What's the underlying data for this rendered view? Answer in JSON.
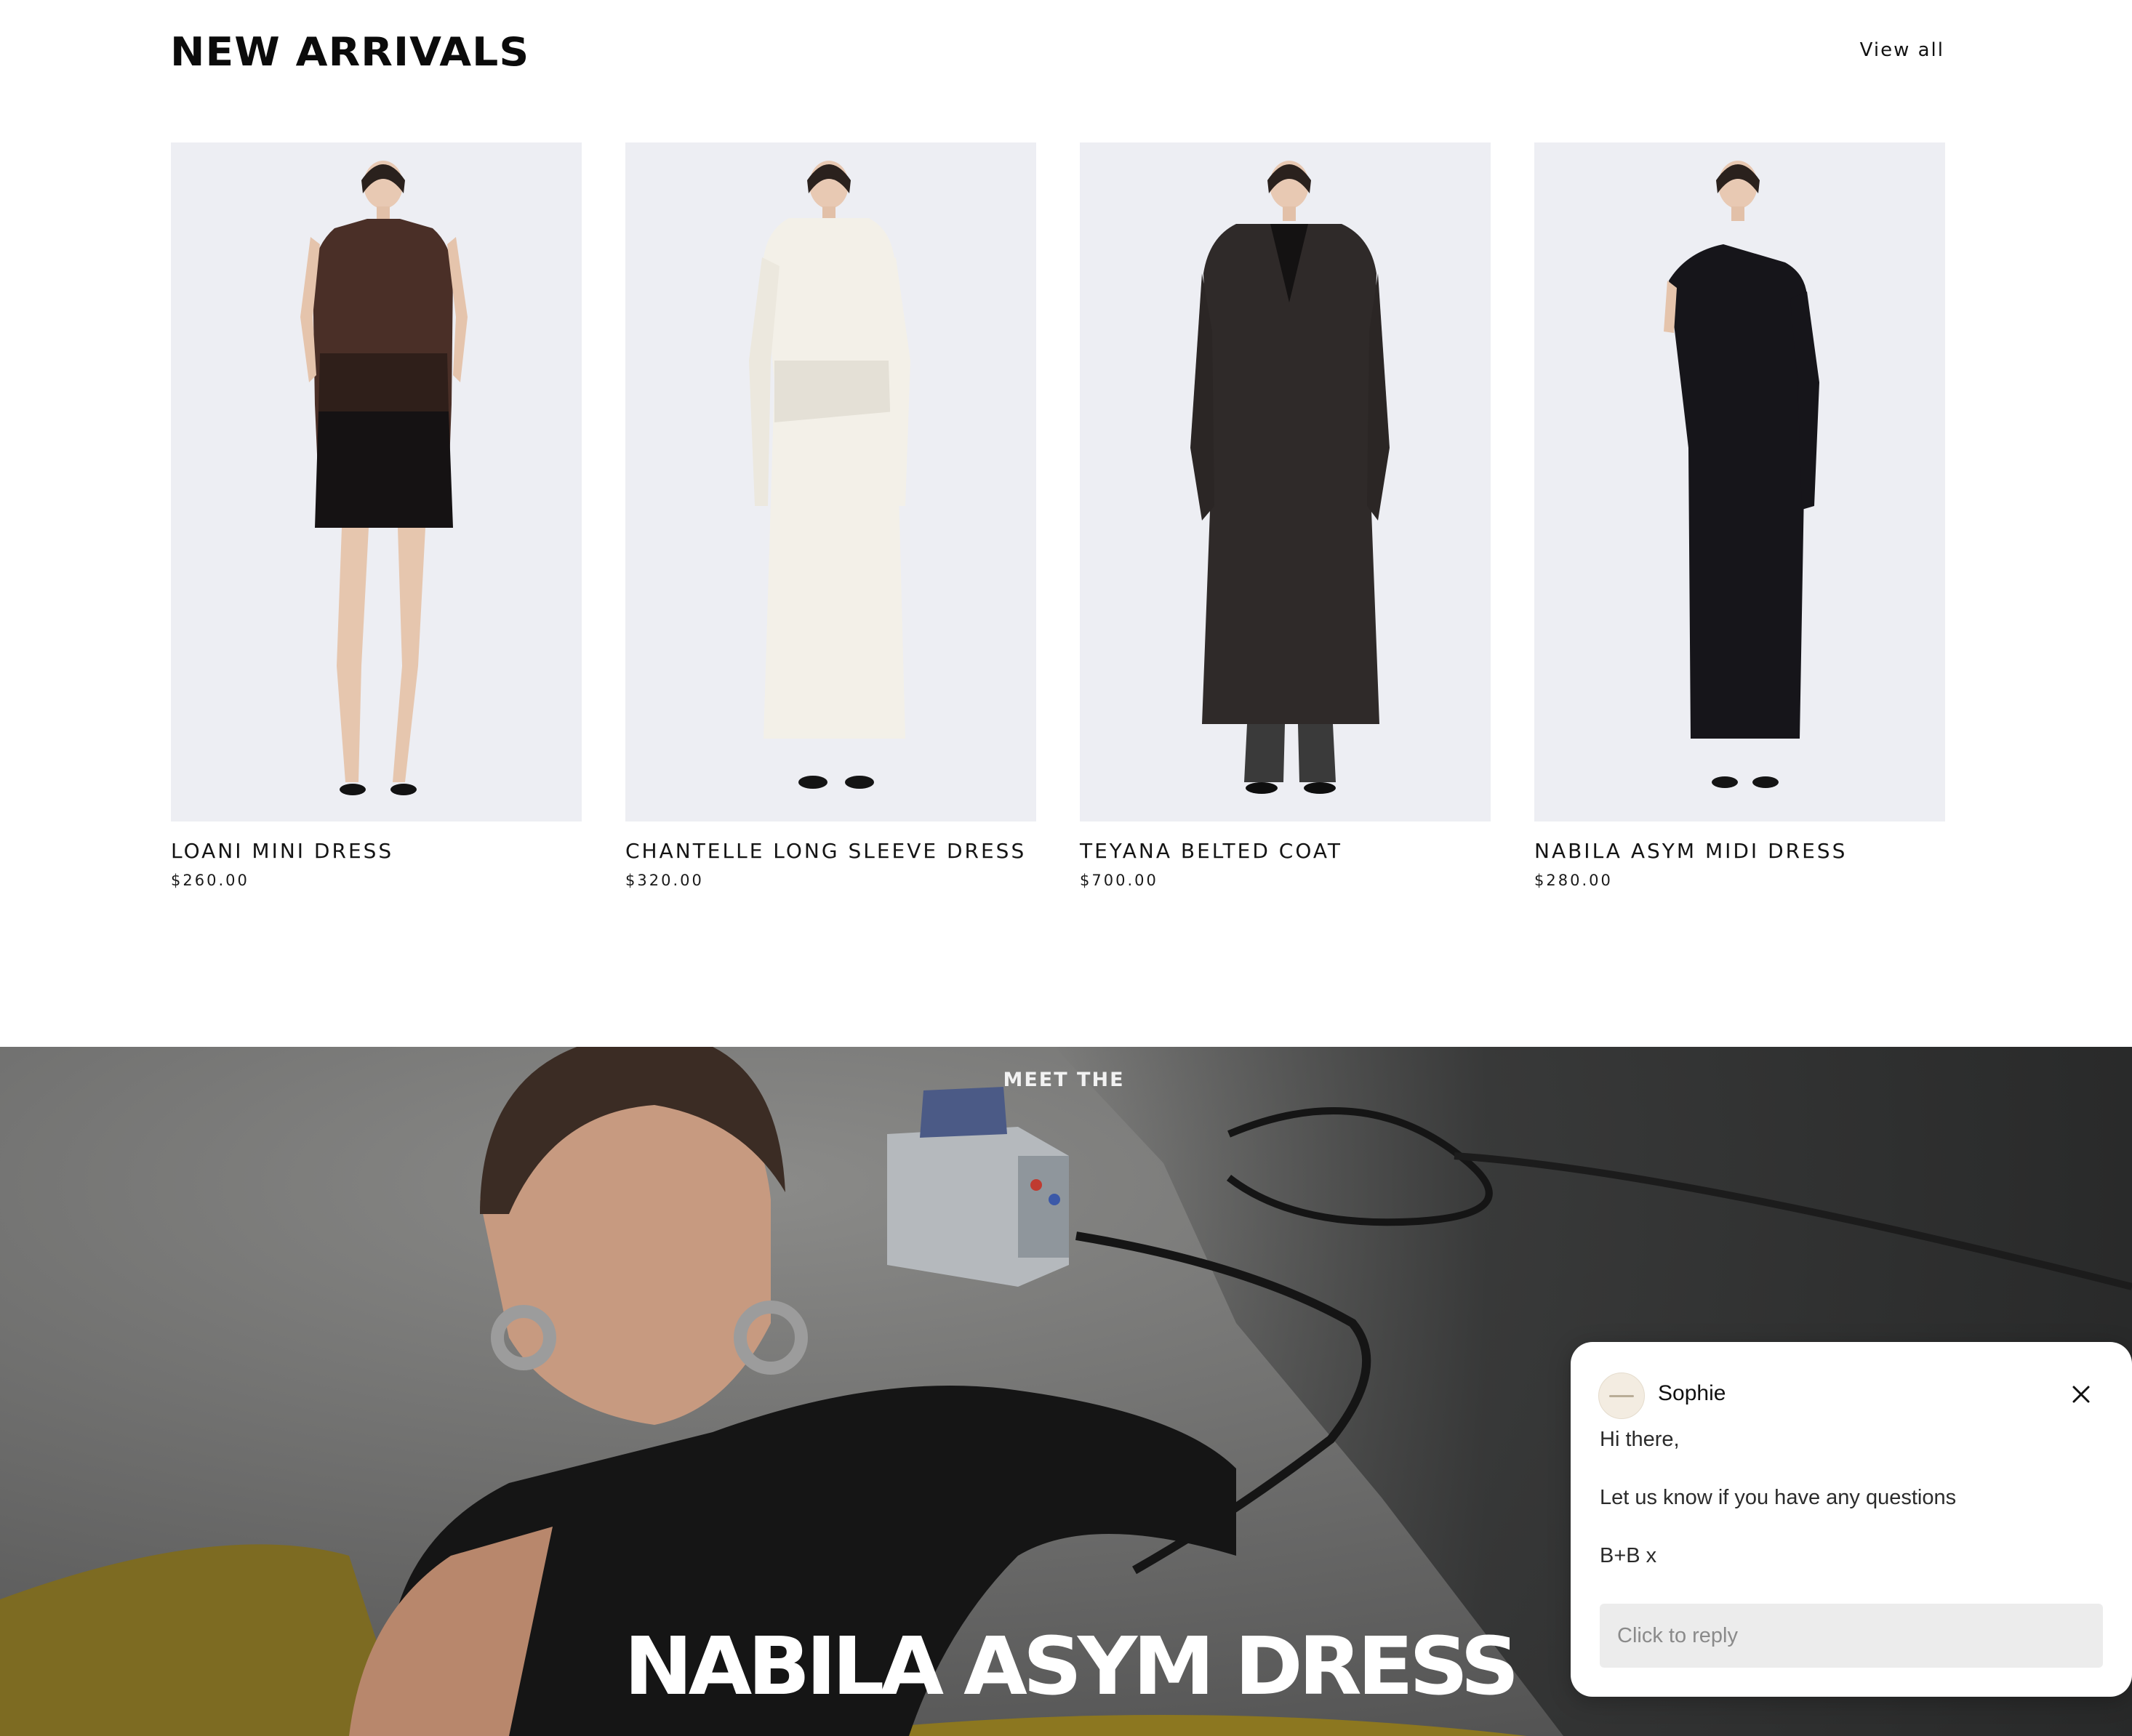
{
  "section": {
    "title": "NEW ARRIVALS",
    "view_all": "View all"
  },
  "products": [
    {
      "name": "LOANI MINI DRESS",
      "price": "$260.00",
      "garment": "brown lace mini dress"
    },
    {
      "name": "CHANTELLE LONG SLEEVE DRESS",
      "price": "$320.00",
      "garment": "ivory long sleeve maxi dress"
    },
    {
      "name": "TEYANA BELTED COAT",
      "price": "$700.00",
      "garment": "charcoal long coat"
    },
    {
      "name": "NABILA ASYM MIDI DRESS",
      "price": "$280.00",
      "garment": "black asymmetric midi dress"
    }
  ],
  "hero": {
    "kicker": "MEET THE",
    "title": "NABILA ASYM DRESS"
  },
  "chat": {
    "agent_name": "Sophie",
    "messages": [
      "Hi there,",
      "Let us know if you have any questions",
      "B+B x"
    ],
    "reply_placeholder": "Click to reply",
    "close_icon": "close-icon"
  },
  "colors": {
    "photo_bg": "#edeef3",
    "text": "#111111",
    "hero_text": "#ffffff",
    "chat_input_bg": "#ececec"
  }
}
